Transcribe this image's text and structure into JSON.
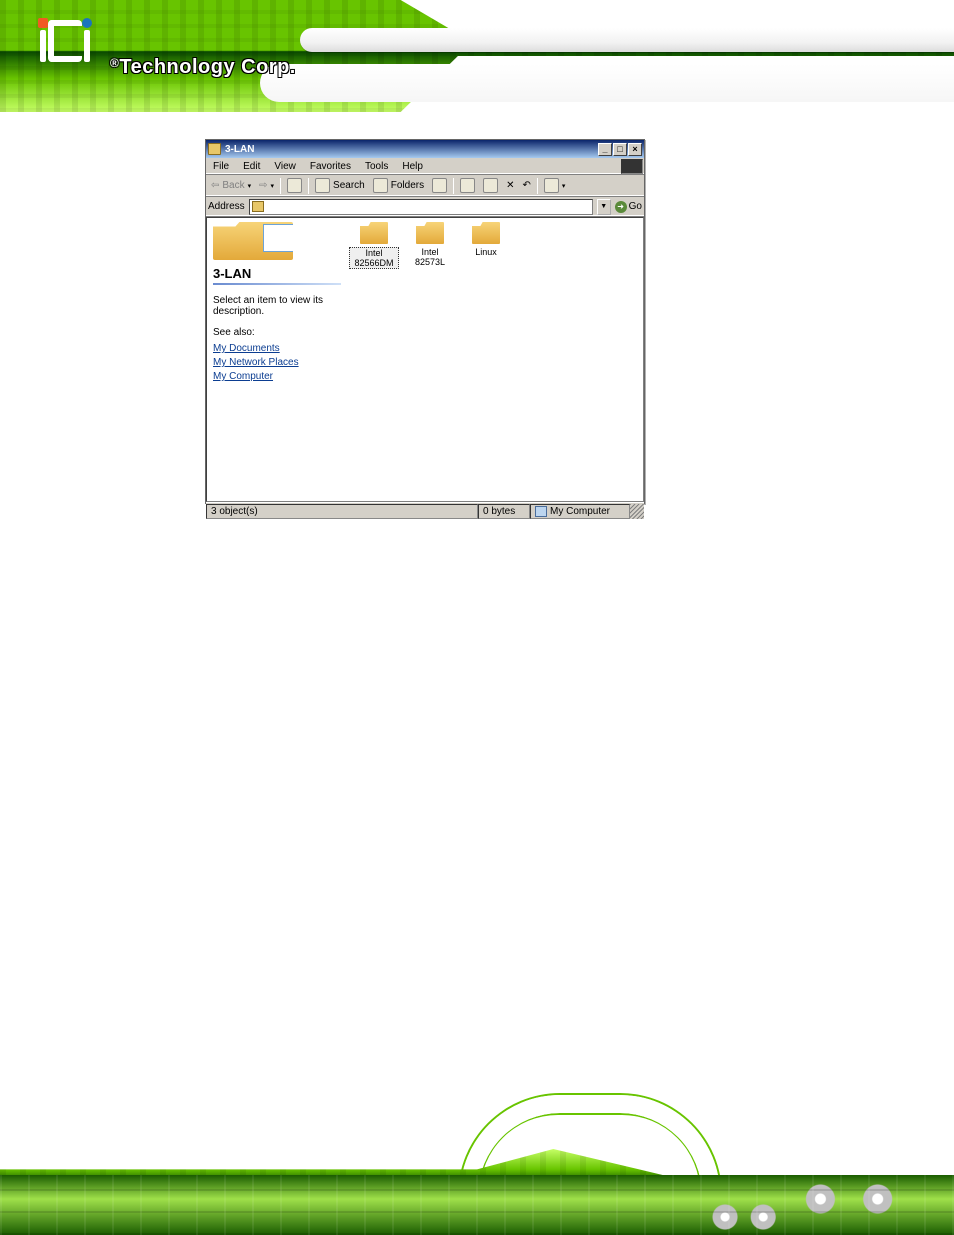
{
  "brand": {
    "reg": "®",
    "name": "Technology Corp."
  },
  "window": {
    "title": "3-LAN",
    "buttons": {
      "min": "_",
      "max": "□",
      "close": "×"
    },
    "menu": [
      "File",
      "Edit",
      "View",
      "Favorites",
      "Tools",
      "Help"
    ],
    "toolbar": {
      "back": "Back",
      "search": "Search",
      "folders": "Folders"
    },
    "address": {
      "label": "Address",
      "go": "Go"
    },
    "leftpane": {
      "title": "3-LAN",
      "hint": "Select an item to view its description.",
      "seeAlso": "See also:",
      "links": [
        "My Documents",
        "My Network Places",
        "My Computer"
      ]
    },
    "items": [
      {
        "label": "Intel 82566DM",
        "selected": true
      },
      {
        "label": "Intel 82573L",
        "selected": false
      },
      {
        "label": "Linux",
        "selected": false
      }
    ],
    "status": {
      "objects": "3 object(s)",
      "size": "0 bytes",
      "location": "My Computer"
    }
  }
}
